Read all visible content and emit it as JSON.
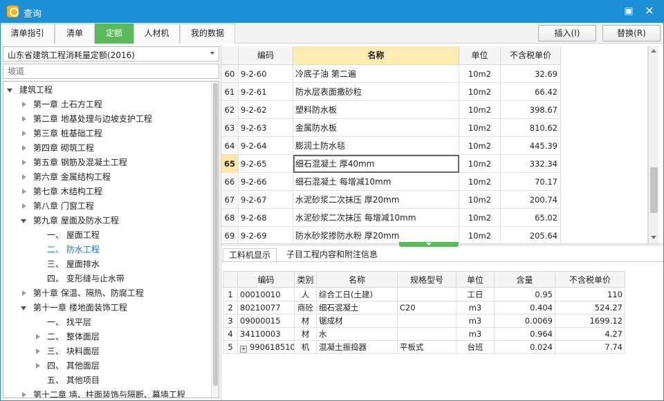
{
  "window": {
    "title": "查询",
    "colors": {
      "titlebar": "#1c8fd6",
      "accent_green": "#5cb85c",
      "highlight": "#fdebb2"
    }
  },
  "tabs": [
    {
      "label": "清单指引"
    },
    {
      "label": "清单"
    },
    {
      "label": "定额",
      "active": true
    },
    {
      "label": "人材机"
    },
    {
      "label": "我的数据"
    }
  ],
  "actions": {
    "insert_label": "插入(I)",
    "replace_label": "替换(R)"
  },
  "left": {
    "quota_library": "山东省建筑工程消耗量定额(2016)",
    "search_placeholder": "坡道",
    "tree": [
      {
        "label": "建筑工程",
        "level": 0,
        "state": "open"
      },
      {
        "label": "第一章 土石方工程",
        "level": 1,
        "state": "closed"
      },
      {
        "label": "第二章 地基处理与边坡支护工程",
        "level": 1,
        "state": "closed"
      },
      {
        "label": "第三章 桩基础工程",
        "level": 1,
        "state": "closed"
      },
      {
        "label": "第四章 砌筑工程",
        "level": 1,
        "state": "closed"
      },
      {
        "label": "第五章 钢筋及混凝土工程",
        "level": 1,
        "state": "closed"
      },
      {
        "label": "第六章 金属结构工程",
        "level": 1,
        "state": "closed"
      },
      {
        "label": "第七章 木结构工程",
        "level": 1,
        "state": "closed"
      },
      {
        "label": "第八章 门窗工程",
        "level": 1,
        "state": "closed"
      },
      {
        "label": "第九章 屋面及防水工程",
        "level": 1,
        "state": "open"
      },
      {
        "label": "一、 屋面工程",
        "level": 2,
        "state": "leaf"
      },
      {
        "label": "二、 防水工程",
        "level": 2,
        "state": "leaf",
        "selected": true
      },
      {
        "label": "三、 屋面排水",
        "level": 2,
        "state": "leaf"
      },
      {
        "label": "四、 变形缝与止水带",
        "level": 2,
        "state": "leaf"
      },
      {
        "label": "第十章 保温、隔热、防腐工程",
        "level": 1,
        "state": "closed"
      },
      {
        "label": "第十一章 楼地面装饰工程",
        "level": 1,
        "state": "open"
      },
      {
        "label": "一、 找平层",
        "level": 2,
        "state": "leaf"
      },
      {
        "label": "二、 整体面层",
        "level": 2,
        "state": "closed"
      },
      {
        "label": "三、 块料面层",
        "level": 2,
        "state": "closed"
      },
      {
        "label": "四、 其他面层",
        "level": 2,
        "state": "closed"
      },
      {
        "label": "五、 其他项目",
        "level": 2,
        "state": "leaf"
      },
      {
        "label": "第十二章 墙、柱面装饰与隔断、幕墙工程",
        "level": 1,
        "state": "closed"
      }
    ]
  },
  "quota_grid": {
    "columns": [
      "",
      "编码",
      "名称",
      "单位",
      "不含税单价"
    ],
    "rows": [
      {
        "no": "60",
        "code": "9-2-60",
        "name": "冷底子油 第二遍",
        "unit": "10m2",
        "price": "32.69"
      },
      {
        "no": "61",
        "code": "9-2-61",
        "name": "防水层表面撒砂粒",
        "unit": "10m2",
        "price": "66.42"
      },
      {
        "no": "62",
        "code": "9-2-62",
        "name": "塑料防水板",
        "unit": "10m2",
        "price": "398.67"
      },
      {
        "no": "63",
        "code": "9-2-63",
        "name": "金属防水板",
        "unit": "10m2",
        "price": "810.62"
      },
      {
        "no": "64",
        "code": "9-2-64",
        "name": "膨润土防水毯",
        "unit": "10m2",
        "price": "445.39"
      },
      {
        "no": "65",
        "code": "9-2-65",
        "name": "细石混凝土 厚40mm",
        "unit": "10m2",
        "price": "332.34",
        "current": true
      },
      {
        "no": "66",
        "code": "9-2-66",
        "name": "细石混凝土 每增减10mm",
        "unit": "10m2",
        "price": "70.17"
      },
      {
        "no": "67",
        "code": "9-2-67",
        "name": "水泥砂浆二次抹压 厚20mm",
        "unit": "10m2",
        "price": "200.74"
      },
      {
        "no": "68",
        "code": "9-2-68",
        "name": "水泥砂浆二次抹压 每增减10mm",
        "unit": "10m2",
        "price": "65.02"
      },
      {
        "no": "69",
        "code": "9-2-69",
        "name": "防水砂浆掺防水粉 厚20mm",
        "unit": "10m2",
        "price": "205.64"
      }
    ]
  },
  "bottom_tabs": [
    {
      "label": "工料机显示",
      "active": true
    },
    {
      "label": "子目工程内容和附注信息"
    }
  ],
  "resources": {
    "columns": [
      "",
      "编码",
      "类别",
      "名称",
      "规格型号",
      "单位",
      "含量",
      "不含税单价"
    ],
    "rows": [
      {
        "no": "1",
        "code": "00010010",
        "type": "人",
        "name": "综合工日(土建)",
        "spec": "",
        "unit": "工日",
        "qty": "0.95",
        "price": "110"
      },
      {
        "no": "2",
        "code": "80210077",
        "type": "商砼",
        "name": "细石混凝土",
        "spec": "C20",
        "unit": "m3",
        "qty": "0.404",
        "price": "524.27"
      },
      {
        "no": "3",
        "code": "09000015",
        "type": "材",
        "name": "锯成材",
        "spec": "",
        "unit": "m3",
        "qty": "0.0069",
        "price": "1699.12"
      },
      {
        "no": "4",
        "code": "34110003",
        "type": "材",
        "name": "水",
        "spec": "",
        "unit": "m3",
        "qty": "0.964",
        "price": "4.27"
      },
      {
        "no": "5",
        "code": "990618510",
        "type": "机",
        "name": "混凝土振捣器",
        "spec": "平板式",
        "unit": "台班",
        "qty": "0.024",
        "price": "7.74",
        "expandable": true
      }
    ]
  }
}
